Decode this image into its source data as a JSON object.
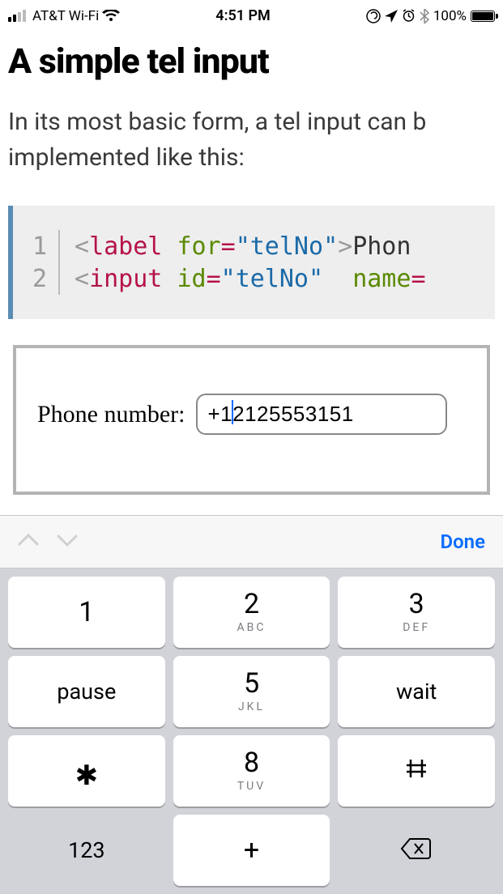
{
  "statusbar": {
    "carrier": "AT&T Wi-Fi",
    "time": "4:51 PM",
    "battery_pct": "100%"
  },
  "article": {
    "heading": "A simple tel input",
    "intro_line1": "In its most basic form, a tel input can b",
    "intro_line2": "implemented like this:"
  },
  "code": {
    "ln1": "1",
    "ln2": "2",
    "l1": {
      "lt": "<",
      "tag": "label",
      "sp": " ",
      "attr": "for",
      "eq": "=",
      "q1": "\"",
      "val": "telNo",
      "q2": "\"",
      "gt": ">",
      "txt": "Phon"
    },
    "l2": {
      "lt": "<",
      "tag": "input",
      "sp": " ",
      "attr": "id",
      "eq": "=",
      "q1": "\"",
      "val": "telNo",
      "q2": "\"",
      "sp2": "  ",
      "attr2": "name",
      "eq2": "="
    }
  },
  "demo": {
    "label": "Phone number:",
    "input_value": "+12125553151"
  },
  "keyboard": {
    "done": "Done",
    "keys": {
      "k1": "1",
      "k2": "2",
      "k2s": "ABC",
      "k3": "3",
      "k3s": "DEF",
      "kpause": "pause",
      "k5": "5",
      "k5s": "JKL",
      "kwait": "wait",
      "kstar": "*",
      "k8": "8",
      "k8s": "TUV",
      "khash": "#",
      "k123": "123",
      "kplus": "+",
      "kdel": "⌫"
    }
  }
}
